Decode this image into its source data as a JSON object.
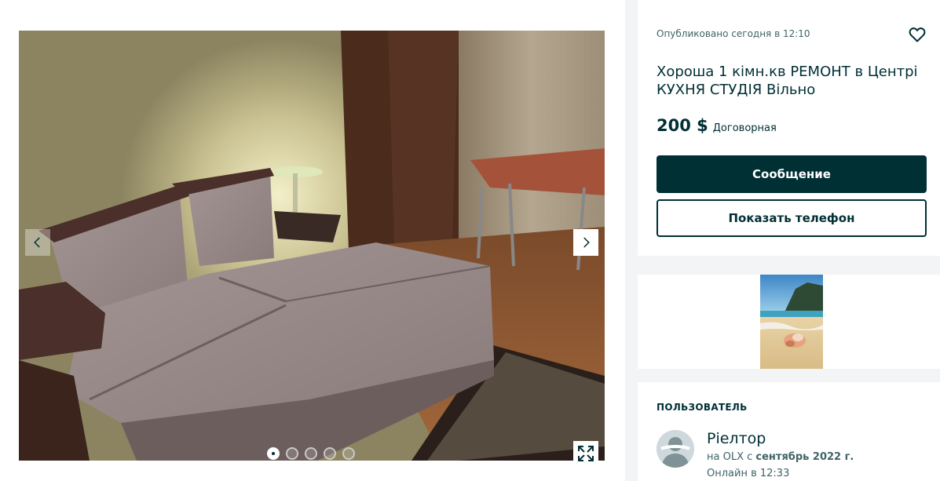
{
  "gallery": {
    "prev_icon": "chevron-left-icon",
    "next_icon": "chevron-right-icon",
    "expand_icon": "expand-icon",
    "photo_count": 5,
    "active_index": 0
  },
  "listing": {
    "published": "Опубликовано сегодня в 12:10",
    "title": "Хороша 1 кімн.кв РЕМОНТ в Центрі КУХНЯ СТУДІЯ Вільно",
    "price": "200 $",
    "price_note": "Договорная",
    "favorite_icon": "heart-icon"
  },
  "actions": {
    "message_label": "Сообщение",
    "phone_label": "Показать телефон"
  },
  "user": {
    "heading": "ПОЛЬЗОВАТЕЛЬ",
    "name": "Ріелтор",
    "since_prefix": "на OLX с",
    "since_date": "сентябрь 2022 г.",
    "online": "Онлайн в 12:33"
  },
  "colors": {
    "brand": "#002f34",
    "page_bg": "#f2f4f5"
  }
}
